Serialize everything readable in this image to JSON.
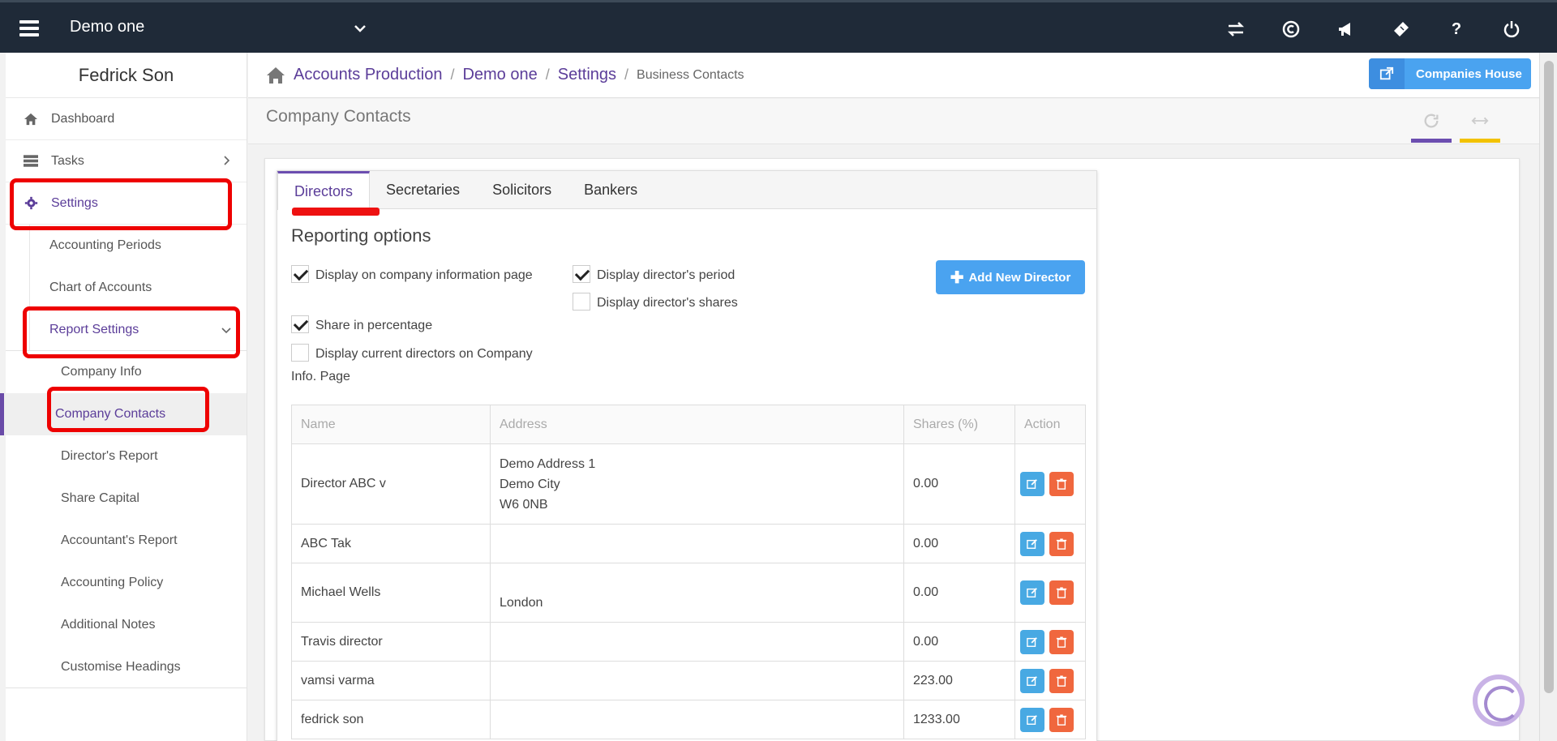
{
  "topbar": {
    "company": "Demo one",
    "icons": [
      "transfer-icon",
      "copyright-icon",
      "megaphone-icon",
      "ticket-icon",
      "help-icon",
      "power-icon"
    ],
    "help_glyph": "?"
  },
  "sidebar": {
    "user_name": "Fedrick Son",
    "items": [
      {
        "label": "Dashboard",
        "icon": "home-icon"
      },
      {
        "label": "Tasks",
        "icon": "list-icon"
      },
      {
        "label": "Settings",
        "icon": "gear-icon"
      }
    ],
    "settings_children": [
      "Accounting Periods",
      "Chart of Accounts",
      "Report Settings"
    ],
    "report_children": [
      "Company Info",
      "Company Contacts",
      "Director's Report",
      "Share Capital",
      "Accountant's Report",
      "Accounting Policy",
      "Additional Notes",
      "Customise Headings"
    ]
  },
  "breadcrumb": {
    "items": [
      "Accounts Production",
      "Demo one",
      "Settings"
    ],
    "current": "Business Contacts",
    "separator": "/"
  },
  "companies_house_label": "Companies House",
  "page_title": "Company Contacts",
  "tabs": [
    "Directors",
    "Secretaries",
    "Solicitors",
    "Bankers"
  ],
  "reporting": {
    "title": "Reporting options",
    "options": [
      {
        "label": "Display on company information page",
        "checked": true
      },
      {
        "label": "Share in percentage",
        "checked": true
      },
      {
        "label": "Display current directors on Company Info. Page",
        "checked": false
      },
      {
        "label": "Display director's period",
        "checked": true
      },
      {
        "label": "Display director's shares",
        "checked": false
      }
    ],
    "add_button": "Add New Director"
  },
  "table": {
    "columns": [
      "Name",
      "Address",
      "Shares (%)",
      "Action"
    ],
    "rows": [
      {
        "name": "Director ABC v",
        "address": [
          "Demo Address 1",
          "Demo City",
          "W6 0NB"
        ],
        "shares": "0.00"
      },
      {
        "name": "ABC Tak",
        "address": [],
        "shares": "0.00"
      },
      {
        "name": "Michael Wells",
        "address": [
          "",
          "London"
        ],
        "shares": "0.00"
      },
      {
        "name": "Travis director",
        "address": [],
        "shares": "0.00"
      },
      {
        "name": "vamsi varma",
        "address": [],
        "shares": "223.00"
      },
      {
        "name": "fedrick son",
        "address": [],
        "shares": "1233.00"
      }
    ]
  },
  "colors": {
    "topbar": "#1f2a38",
    "accent_purple": "#5b3d99",
    "button_blue": "#4aa3f0",
    "delete_orange": "#f0673e",
    "annotation_red": "#e00000"
  }
}
